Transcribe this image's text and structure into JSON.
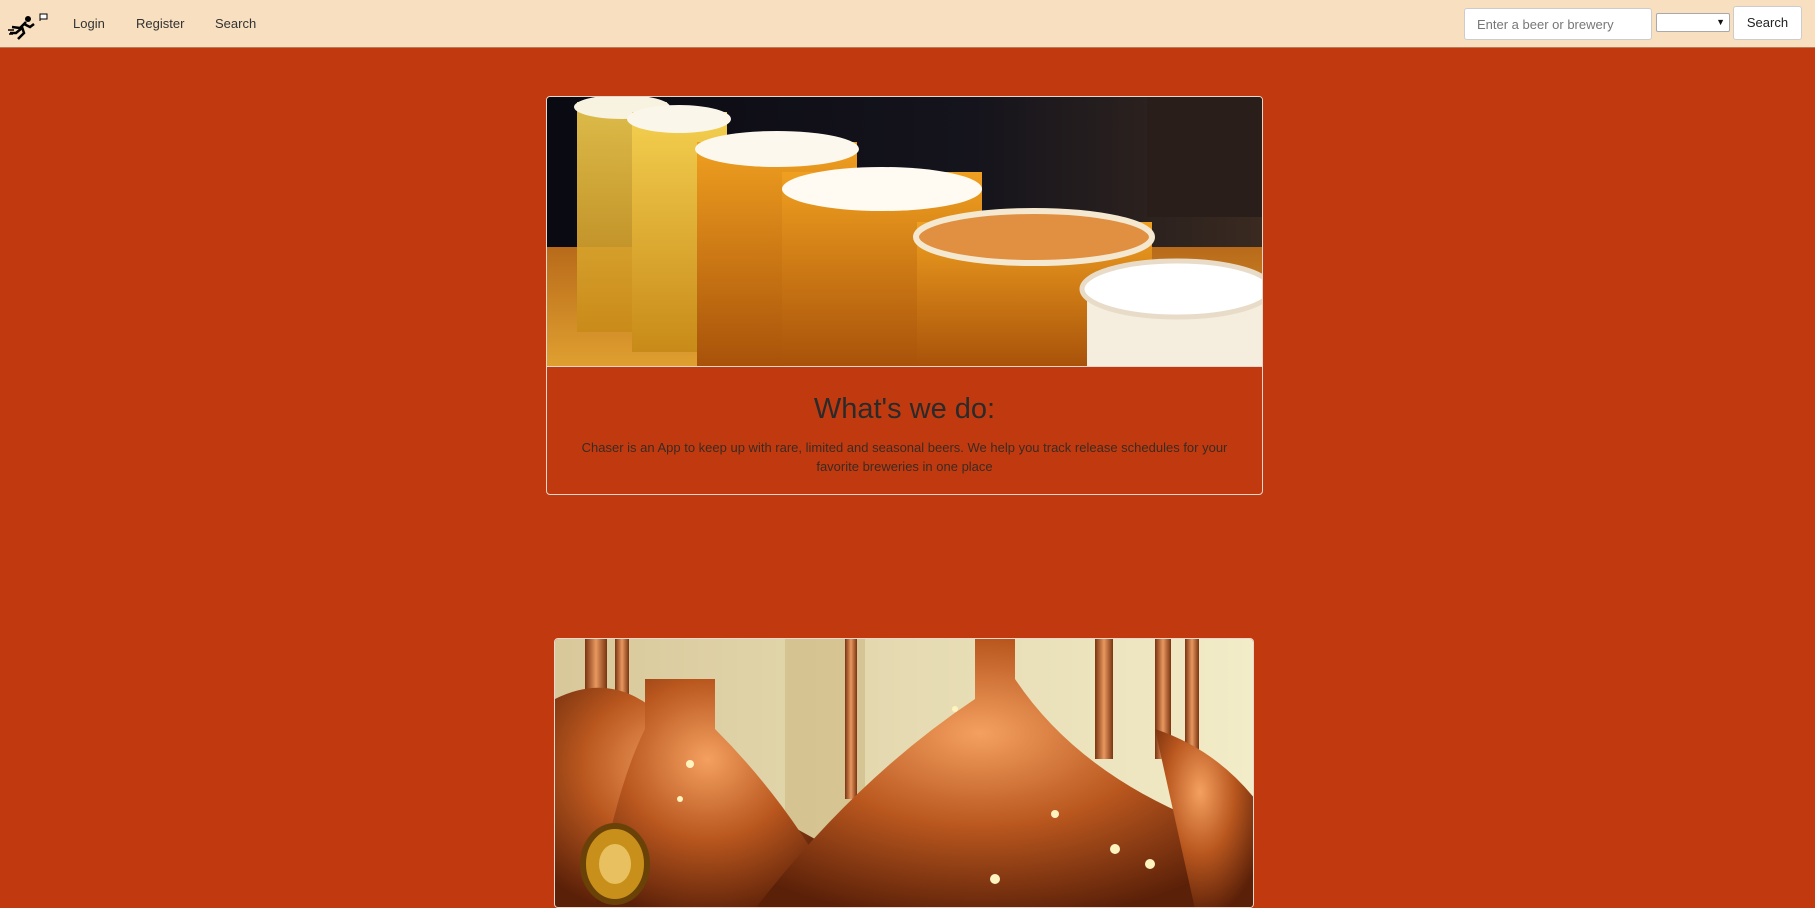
{
  "nav": {
    "brand_icon": "running-man-flag-icon",
    "links": [
      "Login",
      "Register",
      "Search"
    ]
  },
  "search": {
    "placeholder": "Enter a beer or brewery",
    "select_value": "",
    "button_label": "Search"
  },
  "about": {
    "image": "beer-flight-glasses-photo",
    "title": "What's we do:",
    "text": "Chaser is an App to keep up with rare, limited and seasonal beers. We help you track release schedules for your favorite breweries in one place"
  },
  "feature": {
    "image": "copper-brew-kettles-photo"
  },
  "colors": {
    "background": "#c13a0f",
    "navbar": "#f7dfc0"
  }
}
